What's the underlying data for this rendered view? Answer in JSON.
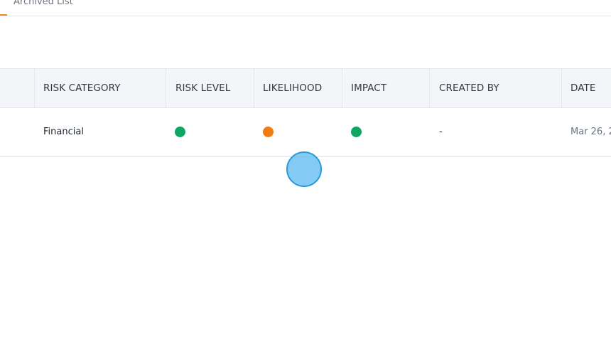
{
  "tabs": {
    "archived_label": "Archived List"
  },
  "table": {
    "columns": [
      "RISK CATEGORY",
      "RISK LEVEL",
      "LIKELIHOOD",
      "IMPACT",
      "CREATED BY",
      "DATE"
    ],
    "rows": [
      {
        "risk_category": "Financial",
        "risk_level": {
          "status": "green",
          "color": "#0fa563"
        },
        "likelihood": {
          "status": "orange",
          "color": "#f07a14"
        },
        "impact": {
          "status": "green",
          "color": "#0fa563"
        },
        "created_by": "-",
        "date": "Mar 26, 2"
      }
    ]
  },
  "colors": {
    "accent": "#e8892a",
    "header_bg": "#f3f5f9",
    "green": "#0fa563",
    "orange": "#f07a14",
    "cursor": "#5ab9f0"
  }
}
